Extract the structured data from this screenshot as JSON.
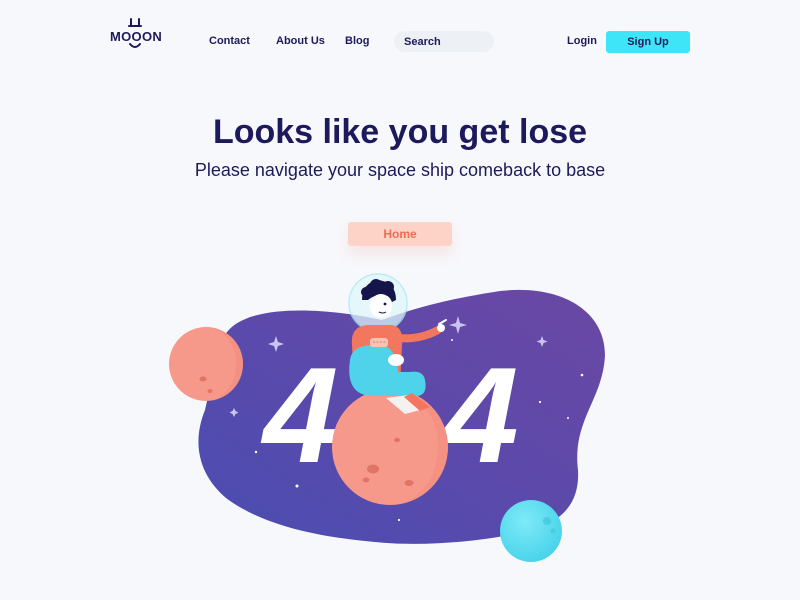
{
  "brand": {
    "name": "MOOON"
  },
  "nav": {
    "links": [
      {
        "label": "Contact"
      },
      {
        "label": "About Us"
      },
      {
        "label": "Blog"
      }
    ],
    "search": {
      "placeholder": "Search"
    },
    "login_label": "Login",
    "signup_label": "Sign Up"
  },
  "hero": {
    "title": "Looks like you get lose",
    "subtitle": "Please navigate your space ship comeback to base",
    "home_label": "Home"
  },
  "error": {
    "first_digit": "4",
    "second_digit": "4"
  },
  "colors": {
    "brand_navy": "#1d1a5c",
    "signup_cyan": "#3ee5f7",
    "home_pink": "#fdd3c7",
    "home_text": "#f06c52",
    "space_purple": "#5a4bab",
    "planet_coral": "#f7998a",
    "planet_cyan": "#55dbef"
  },
  "icons": [
    "logo-antenna-icon",
    "logo-smile-icon",
    "sparkle-star-icon",
    "astronaut-illustration",
    "planet-illustration"
  ]
}
